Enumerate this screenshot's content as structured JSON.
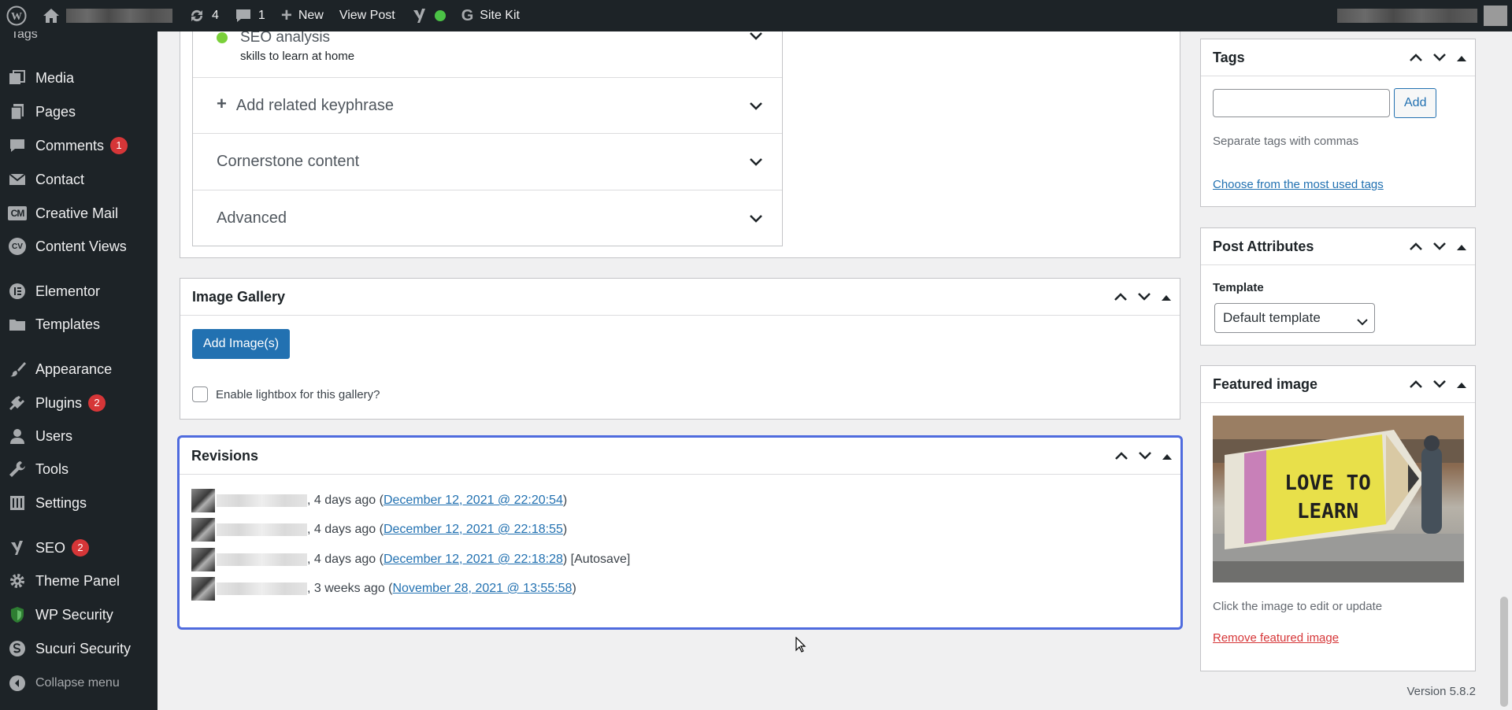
{
  "adminbar": {
    "updates_count": "4",
    "comments_count": "1",
    "new_label": "New",
    "view_post_label": "View Post",
    "site_kit_label": "Site Kit"
  },
  "sidebar": {
    "top_label": "Tags",
    "items": [
      {
        "label": "Media",
        "icon": "media-icon"
      },
      {
        "label": "Pages",
        "icon": "pages-icon"
      },
      {
        "label": "Comments",
        "icon": "comments-icon",
        "badge": "1"
      },
      {
        "label": "Contact",
        "icon": "mail-icon"
      },
      {
        "label": "Creative Mail",
        "icon": "cm-icon"
      },
      {
        "label": "Content Views",
        "icon": "cv-icon"
      },
      {
        "label": "Elementor",
        "icon": "elementor-icon"
      },
      {
        "label": "Templates",
        "icon": "folder-icon"
      },
      {
        "label": "Appearance",
        "icon": "brush-icon"
      },
      {
        "label": "Plugins",
        "icon": "plugin-icon",
        "badge": "2"
      },
      {
        "label": "Users",
        "icon": "user-icon"
      },
      {
        "label": "Tools",
        "icon": "wrench-icon"
      },
      {
        "label": "Settings",
        "icon": "settings-icon"
      },
      {
        "label": "SEO",
        "icon": "yoast-icon",
        "badge": "2"
      },
      {
        "label": "Theme Panel",
        "icon": "gear-icon"
      },
      {
        "label": "WP Security",
        "icon": "shield-icon"
      },
      {
        "label": "Sucuri Security",
        "icon": "sucuri-icon"
      }
    ],
    "collapse_label": "Collapse menu"
  },
  "yoast": {
    "seo_analysis_label": "SEO analysis",
    "seo_analysis_sub": "skills to learn at home",
    "add_related_label": "Add related keyphrase",
    "cornerstone_label": "Cornerstone content",
    "advanced_label": "Advanced"
  },
  "gallery": {
    "title": "Image Gallery",
    "add_button": "Add Image(s)",
    "lightbox_label": "Enable lightbox for this gallery?"
  },
  "revisions": {
    "title": "Revisions",
    "items": [
      {
        "ago": ", 4 days ago (",
        "date": "December 12, 2021 @ 22:20:54",
        "suffix": ")"
      },
      {
        "ago": ", 4 days ago (",
        "date": "December 12, 2021 @ 22:18:55",
        "suffix": ")"
      },
      {
        "ago": ", 4 days ago (",
        "date": "December 12, 2021 @ 22:18:28",
        "suffix": ") [Autosave]"
      },
      {
        "ago": ", 3 weeks ago (",
        "date": "November 28, 2021 @ 13:55:58",
        "suffix": ")"
      }
    ]
  },
  "tags": {
    "title": "Tags",
    "add_button": "Add",
    "hint": "Separate tags with commas",
    "most_used_link": "Choose from the most used tags"
  },
  "post_attributes": {
    "title": "Post Attributes",
    "template_label": "Template",
    "template_value": "Default template"
  },
  "featured_image": {
    "title": "Featured image",
    "image_text_line1": "LOVE TO",
    "image_text_line2": "LEARN",
    "hint": "Click the image to edit or update",
    "remove_link": "Remove featured image"
  },
  "footer": {
    "version": "Version 5.8.2"
  },
  "colors": {
    "adminbar_bg": "#1d2327",
    "accent": "#2271b1",
    "badge": "#d63638",
    "focus_outline": "#4f6bde"
  }
}
